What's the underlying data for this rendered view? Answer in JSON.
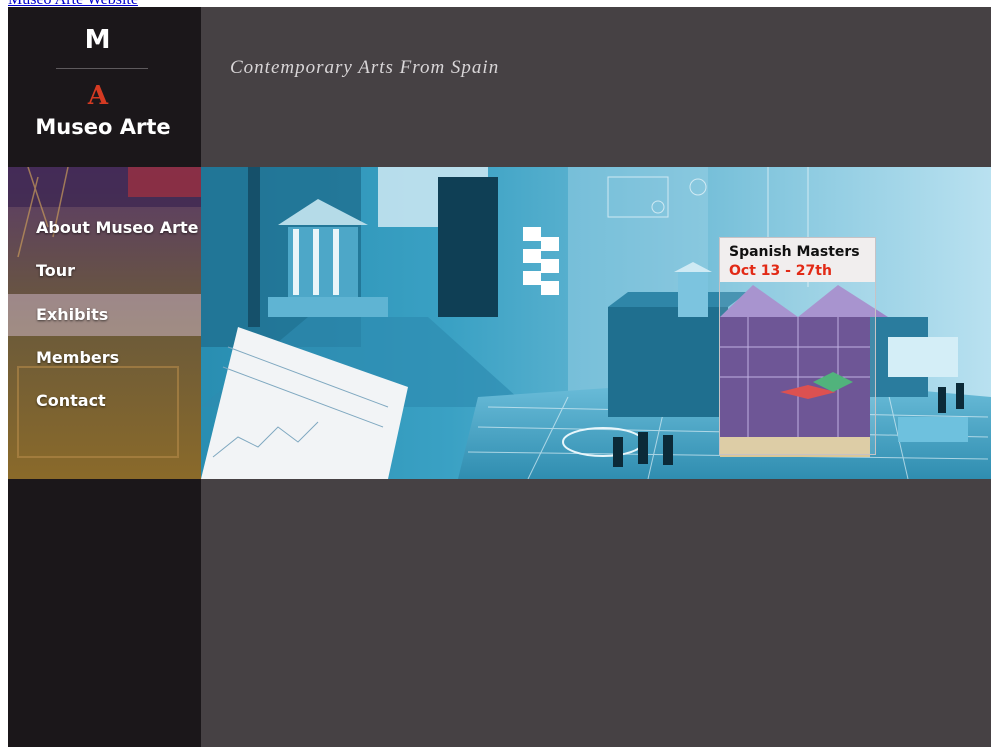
{
  "top_link": {
    "text": "Museo Arte Website"
  },
  "brand": {
    "mark": "M",
    "a_mark": "A",
    "name": "Museo Arte"
  },
  "header": {
    "tagline": "Contemporary Arts From Spain"
  },
  "nav": {
    "active": "Exhibits",
    "items": [
      {
        "label": "About Museo Arte"
      },
      {
        "label": "Tour"
      },
      {
        "label": "Exhibits"
      },
      {
        "label": "Members"
      },
      {
        "label": "Contact"
      }
    ]
  },
  "feature": {
    "title": "Spanish Masters",
    "dates": "Oct 13 - 27th"
  },
  "colors": {
    "background": "#464144",
    "sidebar": "#1b171a",
    "accent_red": "#d53a22",
    "banner_blue": "#3b9ec0",
    "link_blue": "#0000cc"
  }
}
